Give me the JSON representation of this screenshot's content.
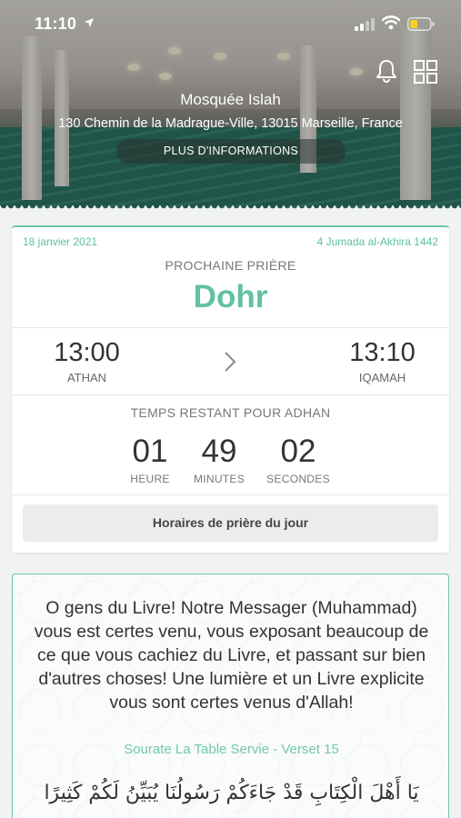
{
  "status_bar": {
    "time": "11:10",
    "icons": [
      "location-arrow-icon",
      "cellular-signal-icon",
      "wifi-icon",
      "battery-icon"
    ],
    "battery_color": "#f5d12c"
  },
  "header": {
    "mosque_name": "Mosquée Islah",
    "address": "130 Chemin de la Madrague-Ville, 13015 Marseille, France",
    "more_info_label": "PLUS D'INFORMATIONS",
    "icons": [
      "bell-icon",
      "grid-icon"
    ]
  },
  "prayer": {
    "gregorian_date": "18 janvier 2021",
    "hijri_date": "4 Jumada al-Akhira 1442",
    "next_label": "PROCHAINE PRIÈRE",
    "name": "Dohr",
    "athan_time": "13:00",
    "athan_label": "ATHAN",
    "iqamah_time": "13:10",
    "iqamah_label": "IQAMAH",
    "remaining_label": "TEMPS RESTANT POUR ADHAN",
    "countdown": {
      "hours": "01",
      "hours_label": "HEURE",
      "minutes": "49",
      "minutes_label": "MINUTES",
      "seconds": "02",
      "seconds_label": "SECONDES"
    },
    "day_times_button": "Horaires de prière du jour",
    "accent_color": "#62c19f"
  },
  "verse": {
    "text": "O gens du Livre! Notre Messager (Muhammad) vous est certes venu, vous exposant beaucoup de ce que vous cachiez du Livre, et passant sur bien d'autres choses! Une lumière et un Livre explicite vous sont certes venus d'Allah!",
    "reference": "Sourate  La Table Servie - Verset 15",
    "arabic": "يَا أَهْلَ الْكِتَابِ قَدْ جَاءَكُمْ رَسُولُنَا يُبَيِّنُ لَكُمْ كَثِيرًا"
  }
}
